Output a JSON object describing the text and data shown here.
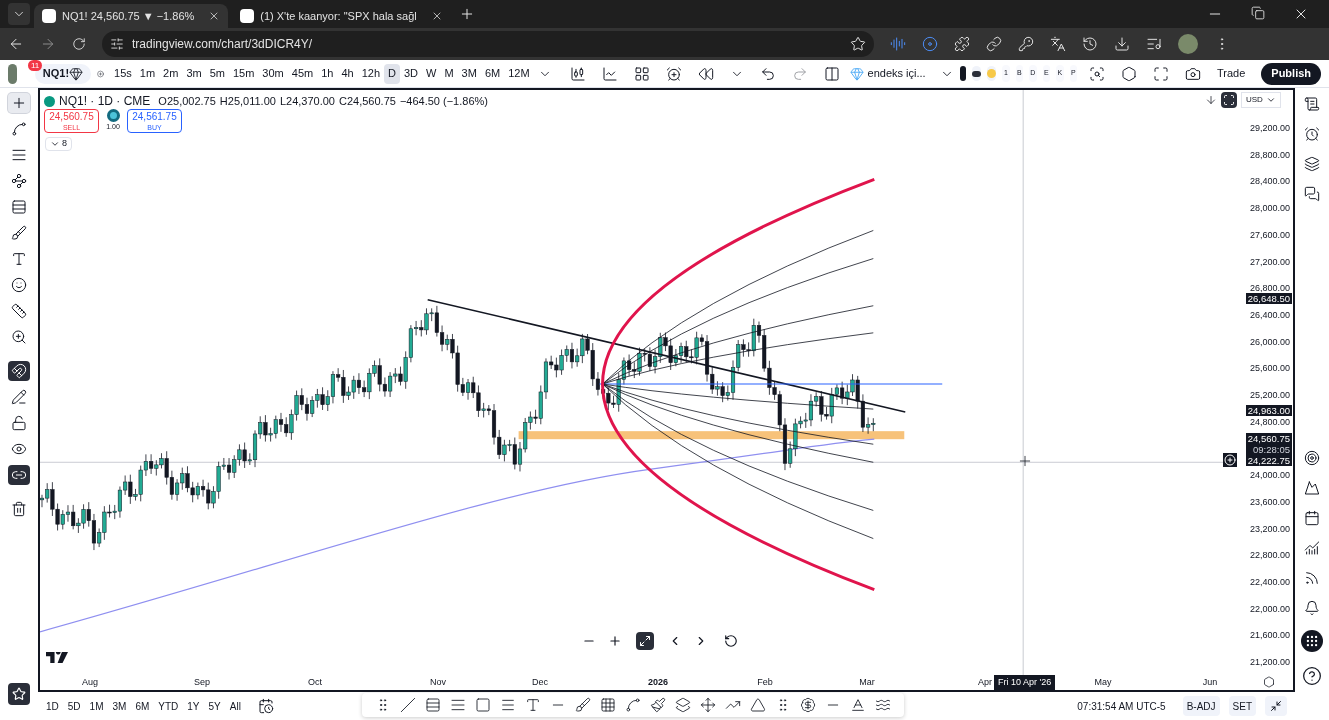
{
  "browser": {
    "tabs": [
      {
        "title": "NQ1! 24,560.75 ▼ −1.86%",
        "selected": true
      },
      {
        "title": "(1) X'te kaanyor: \"SPX hala sağl",
        "selected": false
      }
    ],
    "url": "tradingview.com/chart/3dDICR4Y/"
  },
  "toolbar": {
    "notifications": "11",
    "symbol": "NQ1!",
    "intervals": [
      {
        "label": "15s",
        "selected": false
      },
      {
        "label": "1m",
        "selected": false
      },
      {
        "label": "2m",
        "selected": false
      },
      {
        "label": "3m",
        "selected": false
      },
      {
        "label": "5m",
        "selected": false
      },
      {
        "label": "15m",
        "selected": false
      },
      {
        "label": "30m",
        "selected": false
      },
      {
        "label": "45m",
        "selected": false
      },
      {
        "label": "1h",
        "selected": false
      },
      {
        "label": "4h",
        "selected": false
      },
      {
        "label": "12h",
        "selected": false
      },
      {
        "label": "D",
        "selected": true
      },
      {
        "label": "3D",
        "selected": false
      },
      {
        "label": "W",
        "selected": false
      },
      {
        "label": "M",
        "selected": false
      },
      {
        "label": "3M",
        "selected": false
      },
      {
        "label": "6M",
        "selected": false
      },
      {
        "label": "12M",
        "selected": false
      }
    ],
    "layout_name": "endeks içi...",
    "watchlists": [
      "1",
      "B",
      "D",
      "E",
      "K",
      "P"
    ],
    "trade": "Trade",
    "publish": "Publish"
  },
  "left_tools": [
    {
      "kind": "crosshair",
      "selected": true,
      "on": false
    },
    {
      "kind": "trendline",
      "selected": false,
      "on": false
    },
    {
      "kind": "lines",
      "selected": false,
      "on": false
    },
    {
      "kind": "pattern",
      "selected": false,
      "on": false
    },
    {
      "kind": "fib",
      "selected": false,
      "on": false
    },
    {
      "kind": "brush",
      "selected": false,
      "on": false
    },
    {
      "kind": "text",
      "selected": false,
      "on": false
    },
    {
      "kind": "emoji",
      "selected": false,
      "on": false
    },
    {
      "kind": "ruler",
      "selected": false,
      "on": false
    },
    {
      "kind": "zoom",
      "selected": false,
      "on": false
    },
    {
      "kind": "magnet",
      "selected": false,
      "on": true
    },
    {
      "kind": "lockdraw",
      "selected": false,
      "on": false
    },
    {
      "kind": "lock",
      "selected": false,
      "on": false
    },
    {
      "kind": "eye",
      "selected": false,
      "on": false
    },
    {
      "kind": "link",
      "selected": false,
      "on": true
    },
    {
      "kind": "trash",
      "selected": false,
      "on": false
    }
  ],
  "legend": {
    "symbol": "NQ1! · 1D · CME",
    "open": "O25,002.75",
    "high": "H25,011.00",
    "low": "L24,370.00",
    "close": "C24,560.75",
    "change": "−464.50 (−1.86%)",
    "sell": {
      "price": "24,560.75",
      "label": "SELL"
    },
    "buy": {
      "price": "24,561.75",
      "label": "BUY"
    },
    "quantity": "1.00",
    "indicators": "8"
  },
  "price_axis": {
    "currency": "USD",
    "ticks": [
      "29,200.00",
      "28,800.00",
      "28,400.00",
      "28,000.00",
      "27,600.00",
      "27,200.00",
      "26,800.00",
      "26,400.00",
      "26,000.00",
      "25,600.00",
      "25,200.00",
      "24,800.00",
      "24,000.00",
      "23,600.00",
      "23,200.00",
      "22,800.00",
      "22,400.00",
      "22,000.00",
      "21,600.00",
      "21,200.00"
    ],
    "markers": [
      {
        "text": "26,648.50"
      },
      {
        "text": "24,963.00"
      },
      {
        "text": "24,560.75",
        "sub": "09:28:05"
      },
      {
        "text": "24,222.75"
      }
    ]
  },
  "time_axis": {
    "labels": [
      {
        "text": "Aug",
        "bold": false
      },
      {
        "text": "Sep",
        "bold": false
      },
      {
        "text": "Oct",
        "bold": false
      },
      {
        "text": "Nov",
        "bold": false
      },
      {
        "text": "Dec",
        "bold": false
      },
      {
        "text": "2026",
        "bold": true
      },
      {
        "text": "Feb",
        "bold": false
      },
      {
        "text": "Mar",
        "bold": false
      },
      {
        "text": "Apr",
        "bold": false
      },
      {
        "text": "May",
        "bold": false
      },
      {
        "text": "Jun",
        "bold": false
      }
    ],
    "crosshair_date": "Fri 10 Apr '26"
  },
  "bottom_bar": {
    "ranges": [
      "1D",
      "5D",
      "1M",
      "3M",
      "6M",
      "YTD",
      "1Y",
      "5Y",
      "All"
    ],
    "clock": "07:31:54 AM UTC-5",
    "buttons": [
      "B-ADJ",
      "SET"
    ]
  }
}
